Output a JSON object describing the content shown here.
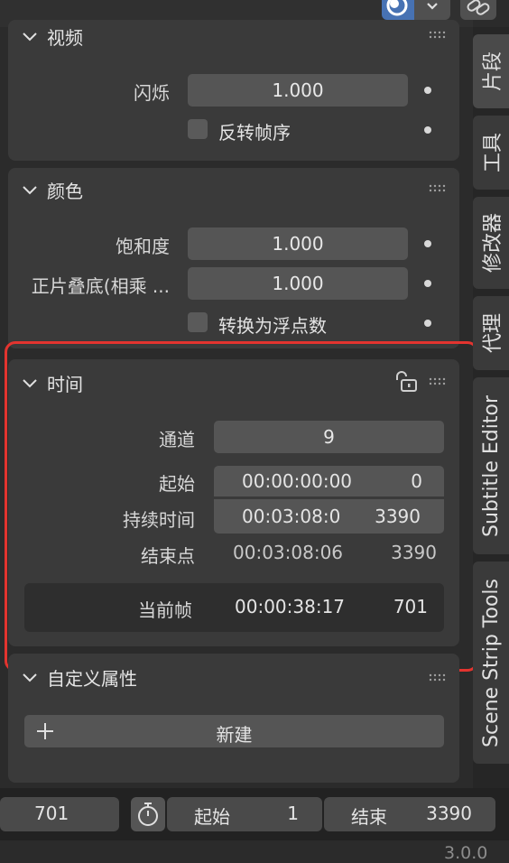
{
  "colors": {
    "accent_blue": "#4772b3",
    "highlight_outline": "#e3342f",
    "panel_bg": "#3a3a3a",
    "field_bg": "#555555"
  },
  "video": {
    "title": "视频",
    "strobe_label": "闪烁",
    "strobe_value": "1.000",
    "reverse_frames_label": "反转帧序"
  },
  "color": {
    "title": "颜色",
    "saturation_label": "饱和度",
    "saturation_value": "1.000",
    "multiply_label": "正片叠底(相乘 ...",
    "multiply_value": "1.000",
    "float_label": "转换为浮点数"
  },
  "time": {
    "title": "时间",
    "channel_label": "通道",
    "channel_value": "9",
    "start_label": "起始",
    "start_timecode": "00:00:00:00",
    "start_frame": "0",
    "duration_label": "持续时间",
    "duration_timecode": "00:03:08:0",
    "duration_frame": "3390",
    "end_label": "结束点",
    "end_timecode": "00:03:08:06",
    "end_frame": "3390",
    "current_label": "当前帧",
    "current_timecode": "00:00:38:17",
    "current_frame": "701"
  },
  "custom_props": {
    "title": "自定义属性",
    "new_button": "新建"
  },
  "tabs": {
    "strip": "片段",
    "tools": "工具",
    "modifiers": "修改器",
    "proxy": "代理",
    "subtitle_editor": "Subtitle Editor",
    "scene_strip_tools": "Scene Strip Tools"
  },
  "timeline": {
    "current_frame": "701",
    "start_label": "起始",
    "start_value": "1",
    "end_label": "结束",
    "end_value": "3390"
  },
  "status": {
    "version": "3.0.0"
  }
}
